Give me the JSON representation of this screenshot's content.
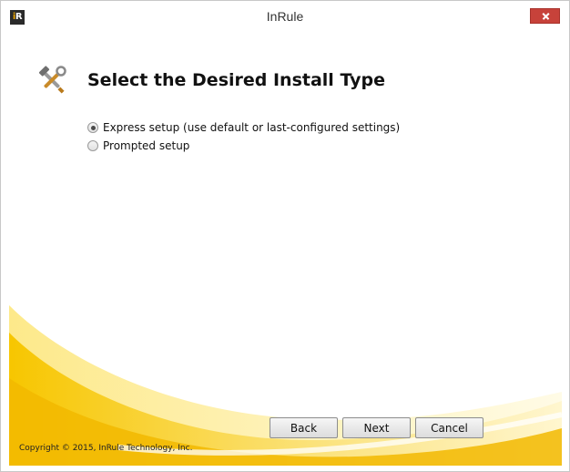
{
  "window": {
    "title": "InRule",
    "icon_letters": [
      "i",
      "R"
    ]
  },
  "page": {
    "heading": "Select the Desired Install Type",
    "header_icon": "tools-icon"
  },
  "options": [
    {
      "label": "Express setup (use default or last-configured settings)",
      "checked": true
    },
    {
      "label": "Prompted setup",
      "checked": false
    }
  ],
  "buttons": {
    "back": "Back",
    "next": "Next",
    "cancel": "Cancel"
  },
  "footer": {
    "copyright": "Copyright © 2015, InRule Technology, Inc."
  },
  "colors": {
    "accent_yellow": "#f5c400",
    "close_red": "#c7423a"
  }
}
